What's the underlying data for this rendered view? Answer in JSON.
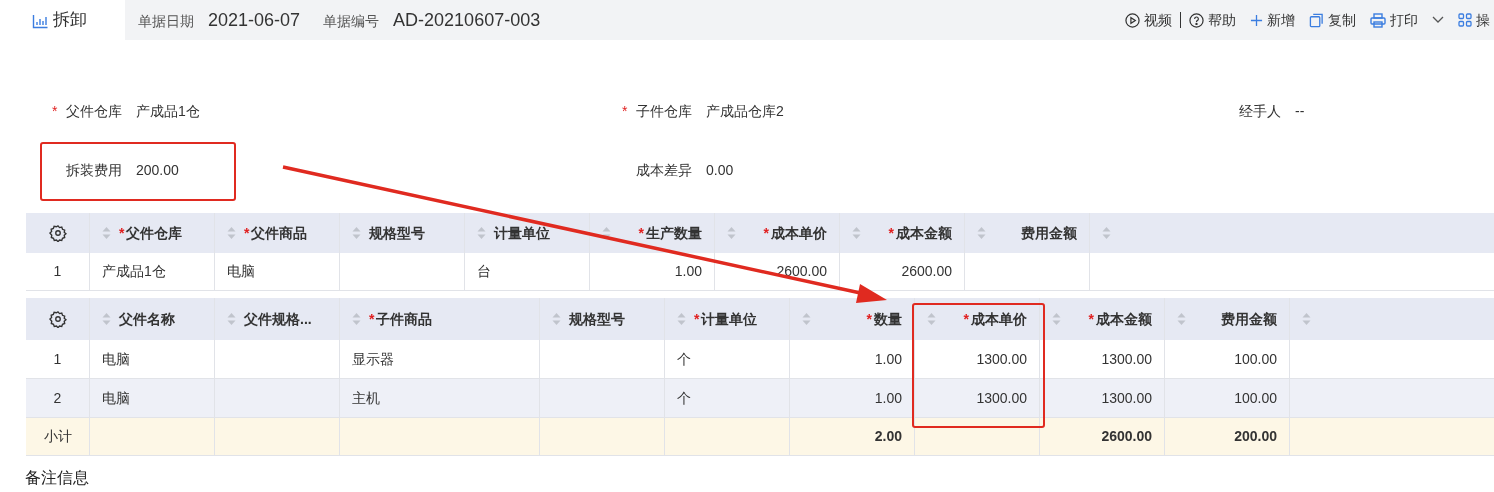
{
  "tab": {
    "label": "拆卸"
  },
  "header_fields": [
    {
      "label": "单据日期",
      "value": "2021-06-07"
    },
    {
      "label": "单据编号",
      "value": "AD-20210607-003"
    }
  ],
  "toolbar": [
    {
      "kind": "video",
      "label": "视频"
    },
    {
      "kind": "help",
      "label": "帮助"
    },
    {
      "kind": "add",
      "label": "新增"
    },
    {
      "kind": "copy",
      "label": "复制"
    },
    {
      "kind": "print",
      "label": "打印"
    },
    {
      "kind": "more",
      "label": "操"
    }
  ],
  "form_rows": [
    [
      {
        "mark": "*",
        "label": "父件仓库",
        "value": "产成品1仓"
      },
      {
        "mark": "*",
        "label": "子件仓库",
        "value": "产成品仓库2"
      },
      {
        "label": "经手人",
        "value": "--"
      }
    ],
    [
      {
        "label": "拆装费用",
        "value": "200.00"
      },
      {
        "label": "成本差异",
        "value": "0.00"
      }
    ]
  ],
  "parent_table": {
    "columns": [
      {
        "mark": "*",
        "label": "父件仓库",
        "numeric": false
      },
      {
        "mark": "*",
        "label": "父件商品",
        "numeric": false
      },
      {
        "label": "规格型号",
        "numeric": false
      },
      {
        "label": "计量单位",
        "numeric": false
      },
      {
        "mark": "*",
        "label": "生产数量",
        "numeric": true
      },
      {
        "mark": "*",
        "label": "成本单价",
        "numeric": true
      },
      {
        "mark": "*",
        "label": "成本金额",
        "numeric": true
      },
      {
        "label": "费用金额",
        "numeric": true
      }
    ],
    "rows": [
      {
        "number": "1",
        "highlighted": false,
        "cells": [
          "产成品1仓",
          "电脑",
          null,
          "台",
          "1.00",
          "2600.00",
          "2600.00",
          null
        ]
      }
    ]
  },
  "child_table": {
    "columns": [
      {
        "label": "父件名称",
        "numeric": false
      },
      {
        "label": "父件规格...",
        "numeric": false
      },
      {
        "mark": "*",
        "label": "子件商品",
        "numeric": false
      },
      {
        "label": "规格型号",
        "numeric": false
      },
      {
        "mark": "*",
        "label": "计量单位",
        "numeric": false
      },
      {
        "mark": "*",
        "label": "数量",
        "numeric": true
      },
      {
        "mark": "*",
        "label": "成本单价",
        "numeric": true
      },
      {
        "mark": "*",
        "label": "成本金额",
        "numeric": true
      },
      {
        "label": "费用金额",
        "numeric": true
      }
    ],
    "rows": [
      {
        "number": "1",
        "highlighted": false,
        "cells": [
          "电脑",
          null,
          "显示器",
          null,
          "个",
          "1.00",
          "1300.00",
          "1300.00",
          "100.00"
        ]
      },
      {
        "number": "2",
        "highlighted": true,
        "cells": [
          "电脑",
          null,
          "主机",
          null,
          "个",
          "1.00",
          "1300.00",
          "1300.00",
          "100.00"
        ]
      }
    ],
    "subtotal": {
      "label": "小计",
      "cells": [
        null,
        null,
        null,
        null,
        null,
        "2.00",
        null,
        "2600.00",
        "200.00"
      ]
    }
  },
  "remarks": {
    "label": "备注信息"
  },
  "annotations": [
    {
      "kind": "box"
    },
    {
      "kind": "box"
    },
    {
      "kind": "arrow"
    }
  ]
}
